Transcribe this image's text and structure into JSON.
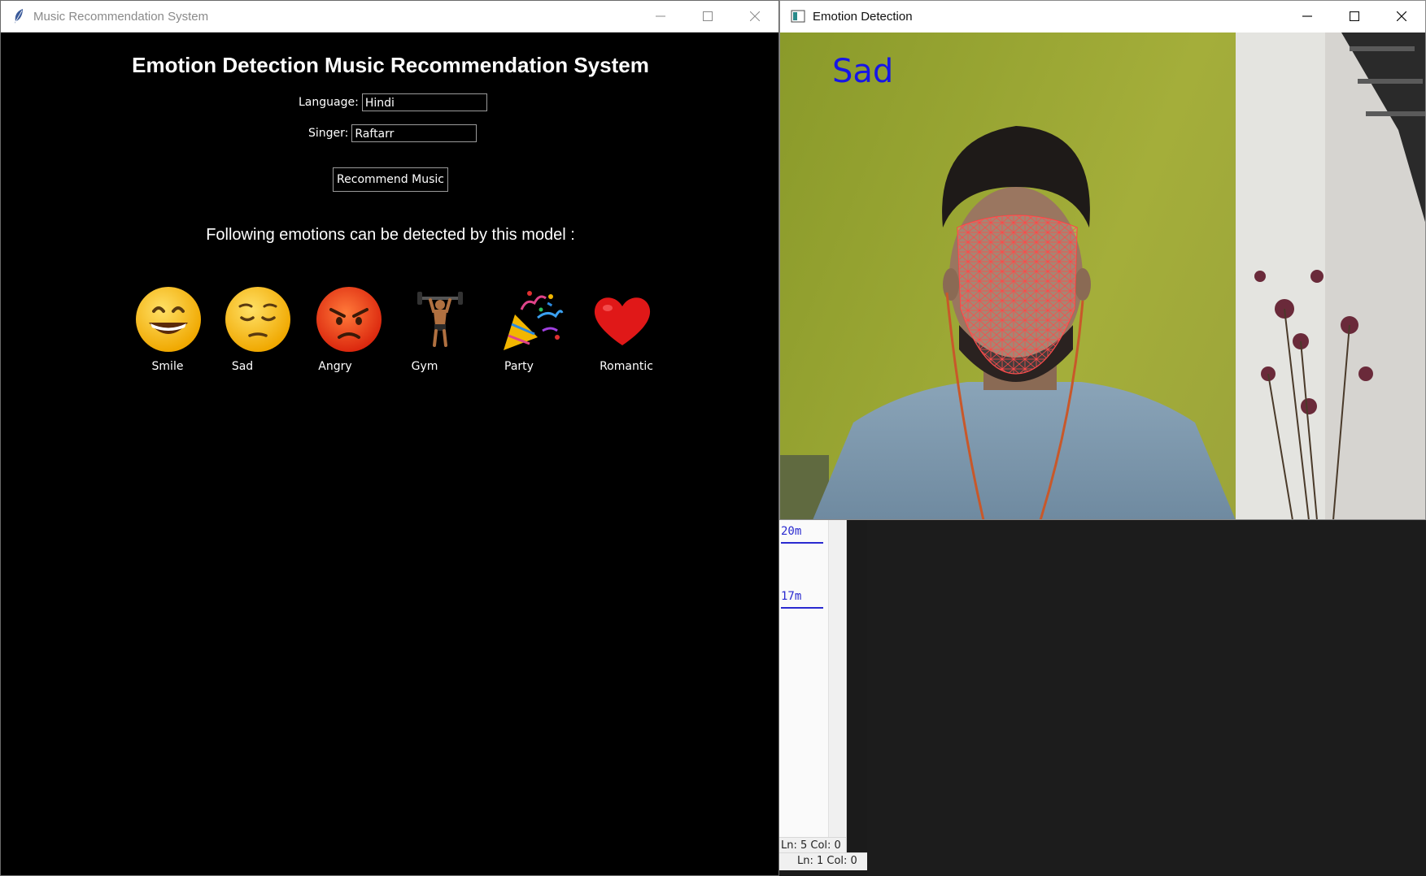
{
  "background": {
    "editor_line1": "20m",
    "editor_line2": "17m",
    "status1": "Ln: 5   Col: 0",
    "status2": "Ln: 1   Col: 0"
  },
  "music_window": {
    "title": "Music Recommendation System",
    "app_title": "Emotion Detection Music Recommendation System",
    "language_label": "Language:",
    "language_value": "Hindi",
    "singer_label": "Singer:",
    "singer_value": "Raftarr",
    "recommend_button": "Recommend Music",
    "emotions_heading": "Following emotions can be detected by this model :",
    "emotions": [
      {
        "label": "Smile",
        "icon": "grinning-face-icon"
      },
      {
        "label": "Sad",
        "icon": "pensive-face-icon"
      },
      {
        "label": "Angry",
        "icon": "angry-face-icon"
      },
      {
        "label": "Gym",
        "icon": "weightlifter-icon"
      },
      {
        "label": "Party",
        "icon": "party-popper-icon"
      },
      {
        "label": "Romantic",
        "icon": "red-heart-icon"
      }
    ]
  },
  "camera_window": {
    "title": "Emotion Detection",
    "detected_emotion": "Sad",
    "label_color": "#1616e6",
    "mesh_color": "#ff2020"
  }
}
